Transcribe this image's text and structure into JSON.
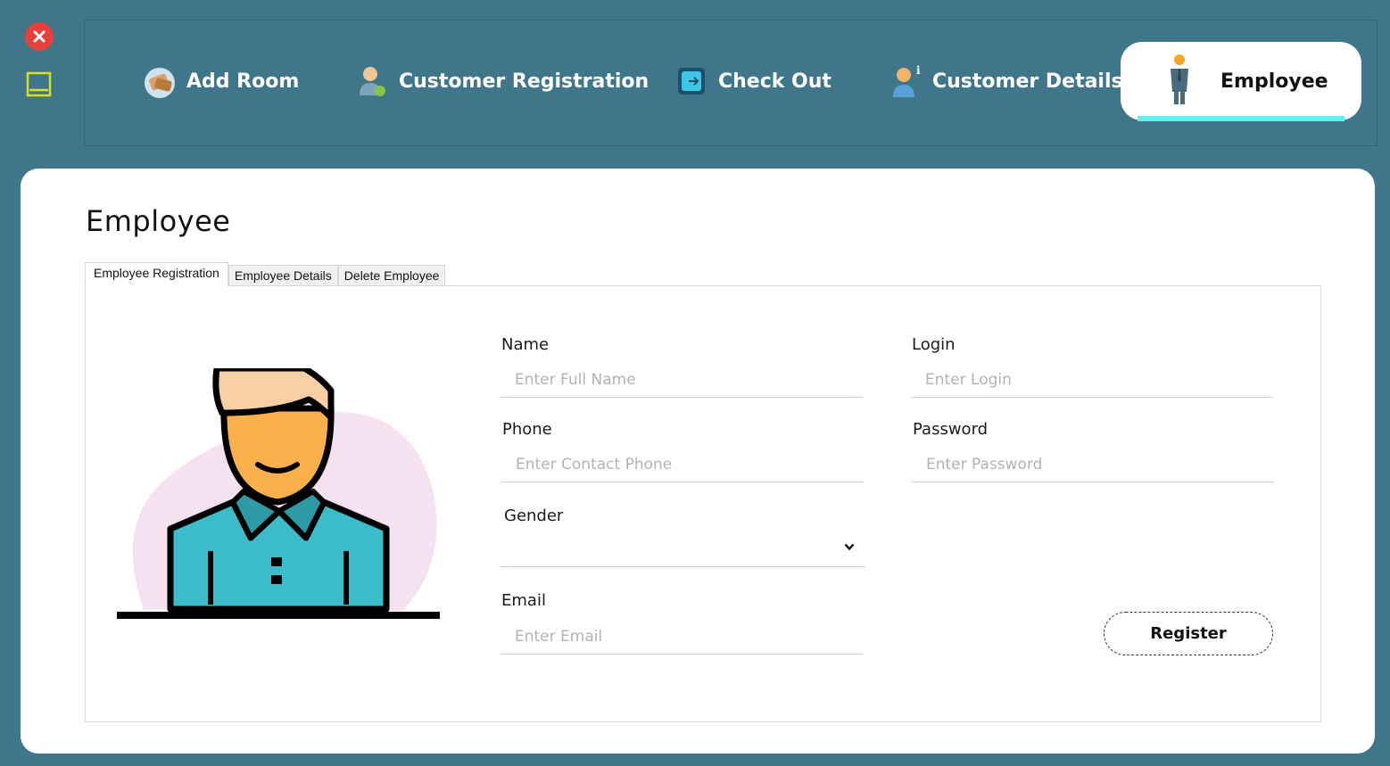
{
  "window": {
    "close_icon": "close-icon",
    "minimize_icon": "minimize-icon",
    "colors": {
      "background": "#3f7689",
      "close": "#e8413c",
      "minimize": "#d9e021",
      "active_underline": "#5cf0f2"
    }
  },
  "nav": {
    "items": [
      {
        "label": "Add Room",
        "icon": "add-room-icon"
      },
      {
        "label": "Customer Registration",
        "icon": "customer-registration-icon"
      },
      {
        "label": "Check Out",
        "icon": "check-out-icon"
      },
      {
        "label": "Customer Details",
        "icon": "customer-details-icon"
      },
      {
        "label": "Employee",
        "icon": "employee-icon",
        "active": true
      }
    ]
  },
  "page": {
    "title": "Employee",
    "tabs": [
      {
        "label": "Employee Registration",
        "selected": true
      },
      {
        "label": "Employee Details"
      },
      {
        "label": "Delete Employee"
      }
    ]
  },
  "form": {
    "name": {
      "label": "Name",
      "placeholder": "Enter Full Name",
      "value": ""
    },
    "phone": {
      "label": "Phone",
      "placeholder": "Enter Contact Phone",
      "value": ""
    },
    "gender": {
      "label": "Gender",
      "selected": ""
    },
    "email": {
      "label": "Email",
      "placeholder": "Enter Email",
      "value": ""
    },
    "login": {
      "label": "Login",
      "placeholder": "Enter Login",
      "value": ""
    },
    "password": {
      "label": "Password",
      "placeholder": "Enter Password",
      "value": ""
    },
    "register_label": "Register"
  }
}
